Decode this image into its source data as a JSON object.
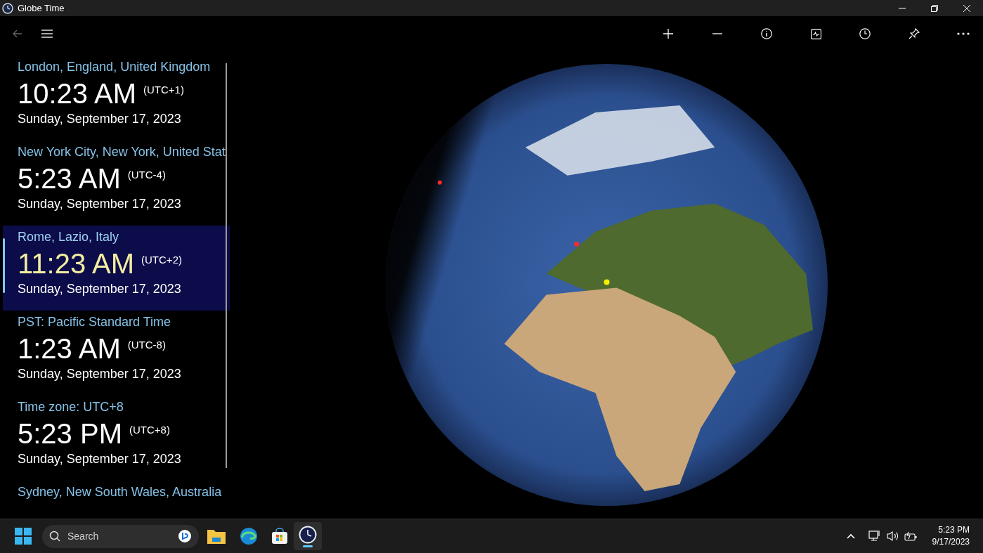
{
  "window": {
    "title": "Globe Time"
  },
  "locations": [
    {
      "name": "London, England, United Kingdom",
      "time": "10:23 AM",
      "offset": "(UTC+1)",
      "date": "Sunday, September 17, 2023",
      "selected": false
    },
    {
      "name": "New York City, New York, United Stat",
      "time": "5:23 AM",
      "offset": "(UTC-4)",
      "date": "Sunday, September 17, 2023",
      "selected": false
    },
    {
      "name": "Rome, Lazio, Italy",
      "time": "11:23 AM",
      "offset": "(UTC+2)",
      "date": "Sunday, September 17, 2023",
      "selected": true
    },
    {
      "name": "PST: Pacific Standard Time",
      "time": "1:23 AM",
      "offset": "(UTC-8)",
      "date": "Sunday, September 17, 2023",
      "selected": false
    },
    {
      "name": "Time zone: UTC+8",
      "time": "5:23 PM",
      "offset": "(UTC+8)",
      "date": "Sunday, September 17, 2023",
      "selected": false
    },
    {
      "name": "Sydney, New South Wales, Australia",
      "selected": false
    }
  ],
  "taskbar": {
    "search_placeholder": "Search",
    "time": "5:23 PM",
    "date": "9/17/2023"
  }
}
